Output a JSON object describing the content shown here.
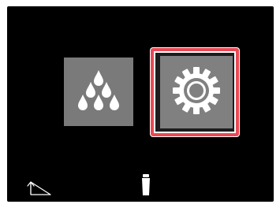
{
  "menu": {
    "tiles": [
      {
        "icon": "water-drops-icon",
        "selected": false
      },
      {
        "icon": "gear-icon",
        "selected": true
      }
    ],
    "selection_color": "#e94a55"
  },
  "footer": {
    "back_icon": "back-arrow-icon",
    "device_icon": "device-icon"
  },
  "colors": {
    "background": "#000000",
    "tile": "#7a7a7a",
    "icon": "#ffffff"
  }
}
